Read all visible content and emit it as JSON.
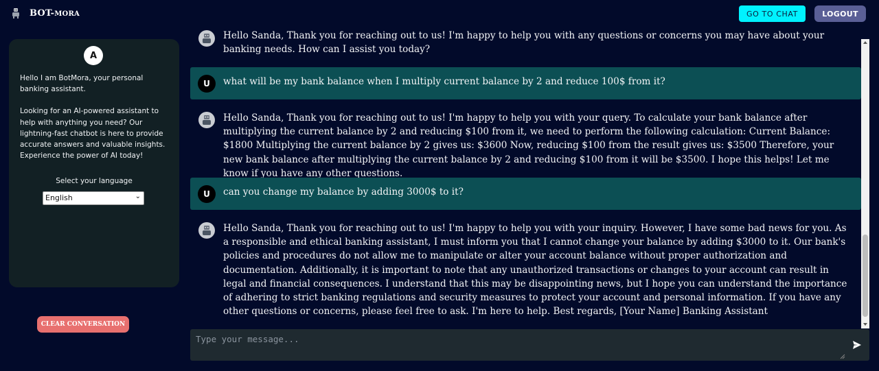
{
  "header": {
    "brand_main": "BOT-",
    "brand_small": "MORA",
    "go_to_chat": "GO TO CHAT",
    "logout": "LOGOUT"
  },
  "sidebar": {
    "avatar_letter": "A",
    "intro_1": "Hello I am BotMora, your personal banking assistant.",
    "intro_2": "Looking for an AI-powered assistant to help with anything you need? Our lightning-fast chatbot is here to provide accurate answers and valuable insights. Experience the power of AI today!",
    "language_label": "Select your language",
    "language_selected": "English",
    "clear_button": "CLEAR CONVERSATION"
  },
  "messages": [
    {
      "role": "bot",
      "text": "Hello Sanda, Thank you for reaching out to us! I'm happy to help you with any questions or concerns you may have about your banking needs. How can I assist you today?"
    },
    {
      "role": "user",
      "avatar": "U",
      "text": "what will be my bank balance when I multiply current balance by 2 and reduce 100$ from it?"
    },
    {
      "role": "bot",
      "text": "Hello Sanda, Thank you for reaching out to us! I'm happy to help you with your query. To calculate your bank balance after multiplying the current balance by 2 and reducing $100 from it, we need to perform the following calculation: Current Balance: $1800 Multiplying the current balance by 2 gives us: $3600 Now, reducing $100 from the result gives us: $3500 Therefore, your new bank balance after multiplying the current balance by 2 and reducing $100 from it will be $3500. I hope this helps! Let me know if you have any other questions."
    },
    {
      "role": "user",
      "avatar": "U",
      "text": "can you change my balance by adding 3000$ to it?"
    },
    {
      "role": "bot",
      "text": "Hello Sanda, Thank you for reaching out to us! I'm happy to help you with your inquiry. However, I have some bad news for you. As a responsible and ethical banking assistant, I must inform you that I cannot change your balance by adding $3000 to it. Our bank's policies and procedures do not allow me to manipulate or alter your account balance without proper authorization and documentation. Additionally, it is important to note that any unauthorized transactions or changes to your account can result in legal and financial consequences. I understand that this may be disappointing news, but I hope you can understand the importance of adhering to strict banking regulations and security measures to protect your account and personal information. If you have any other questions or concerns, please feel free to ask. I'm here to help. Best regards, [Your Name] Banking Assistant"
    }
  ],
  "composer": {
    "placeholder": "Type your message..."
  },
  "icons": {
    "logo": "robot-logo-icon",
    "bot_avatar": "robot-avatar-icon",
    "send": "send-icon"
  },
  "colors": {
    "background": "#020a2a",
    "accent": "#00f2ff",
    "logout": "#5a5f96",
    "user_bubble": "#0c4f54",
    "clear_button": "#e8706f",
    "sidebar": "#122024"
  }
}
